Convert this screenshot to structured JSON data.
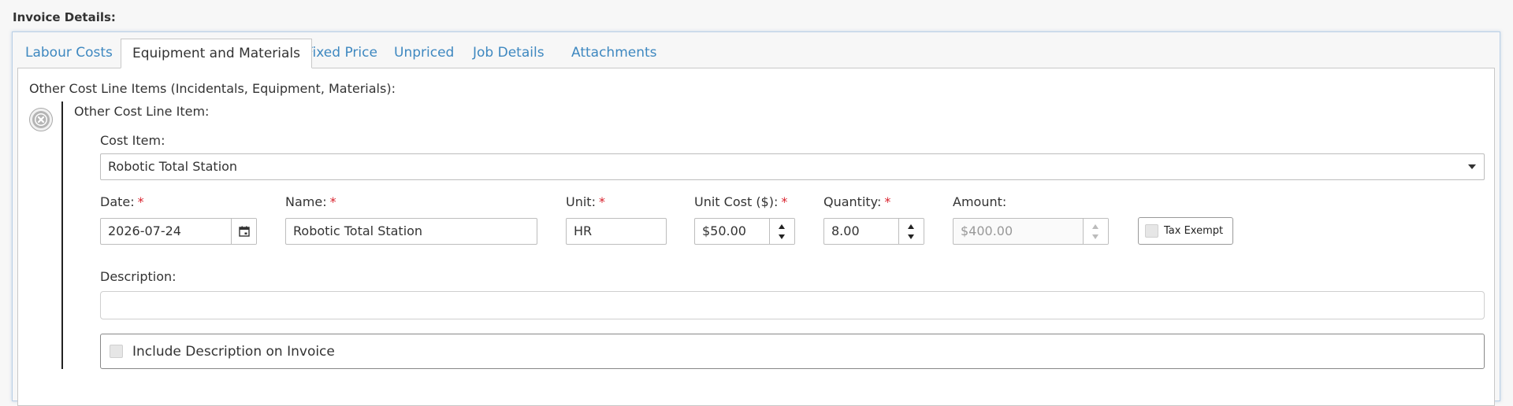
{
  "section_title": "Invoice Details:",
  "tabs": [
    {
      "label": "Labour Costs",
      "active": false
    },
    {
      "label": "Equipment and Materials",
      "active": true
    },
    {
      "label": "Fixed Price",
      "active": false
    },
    {
      "label": "Unpriced",
      "active": false
    },
    {
      "label": "Job Details",
      "active": false
    },
    {
      "label": "Attachments",
      "active": false
    }
  ],
  "items_heading": "Other Cost Line Items (Incidentals, Equipment, Materials):",
  "line_item": {
    "heading": "Other Cost Line Item:",
    "cost_item": {
      "label": "Cost Item:",
      "value": "Robotic Total Station"
    },
    "date": {
      "label": "Date:",
      "value": "2026-07-24"
    },
    "name": {
      "label": "Name:",
      "value": "Robotic Total Station"
    },
    "unit": {
      "label": "Unit:",
      "value": "HR"
    },
    "unit_cost": {
      "label": "Unit Cost ($):",
      "value": "$50.00"
    },
    "quantity": {
      "label": "Quantity:",
      "value": "8.00"
    },
    "amount": {
      "label": "Amount:",
      "value": "$400.00"
    },
    "tax_exempt_label": "Tax Exempt",
    "description": {
      "label": "Description:",
      "value": ""
    },
    "include_description_label": "Include Description on Invoice",
    "required_marker": "*"
  },
  "colors": {
    "link": "#3e88c0",
    "required": "#d9232e",
    "panel_border": "#b9cfe6"
  },
  "icons": {
    "remove": "close-circle-icon",
    "calendar": "calendar-icon",
    "dropdown": "chevron-down-icon"
  }
}
